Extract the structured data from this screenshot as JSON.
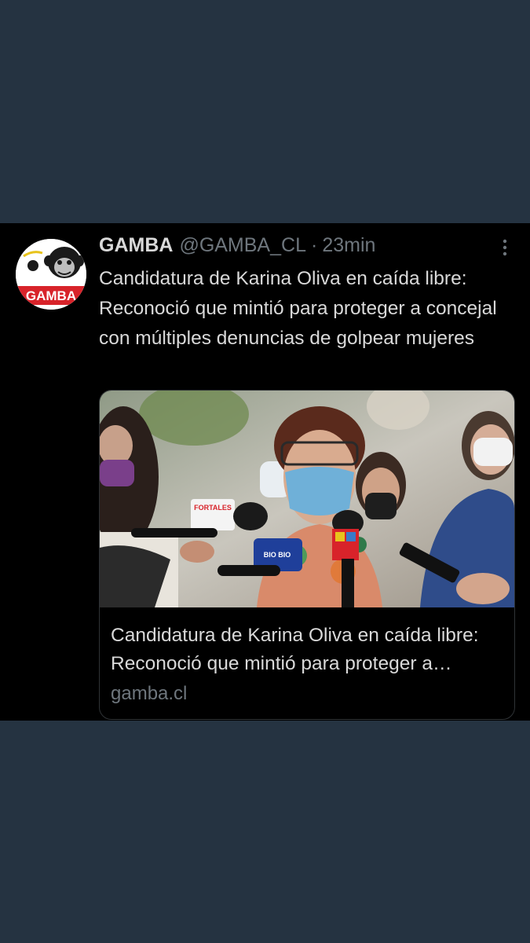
{
  "tweet": {
    "avatar_icon": "gamba-chimp-logo",
    "avatar_text": "GAMBA",
    "display_name": "GAMBA",
    "handle": "@GAMBA_CL",
    "separator": "·",
    "time": "23min",
    "more_icon": "more-vertical-icon",
    "text": "Candidatura de Karina Oliva en caída libre: Reconoció que mintió para proteger a concejal con múltiples denuncias de golpear mujeres"
  },
  "card": {
    "image_description_icon": "press-conference-photo",
    "title": "Candidatura de Karina Oliva en caída libre: Reconoció que mintió para proteger a concejal con múltiples denuncias de golpear mujeres",
    "domain": "gamba.cl",
    "mic_labels": [
      "FORTALES",
      "BIO BIO"
    ]
  },
  "colors": {
    "page_background": "#253341",
    "tweet_background": "#000000",
    "primary_text": "#d9d9d9",
    "secondary_text": "#6e767d",
    "card_border": "#2f3336",
    "logo_red": "#d8232a"
  }
}
